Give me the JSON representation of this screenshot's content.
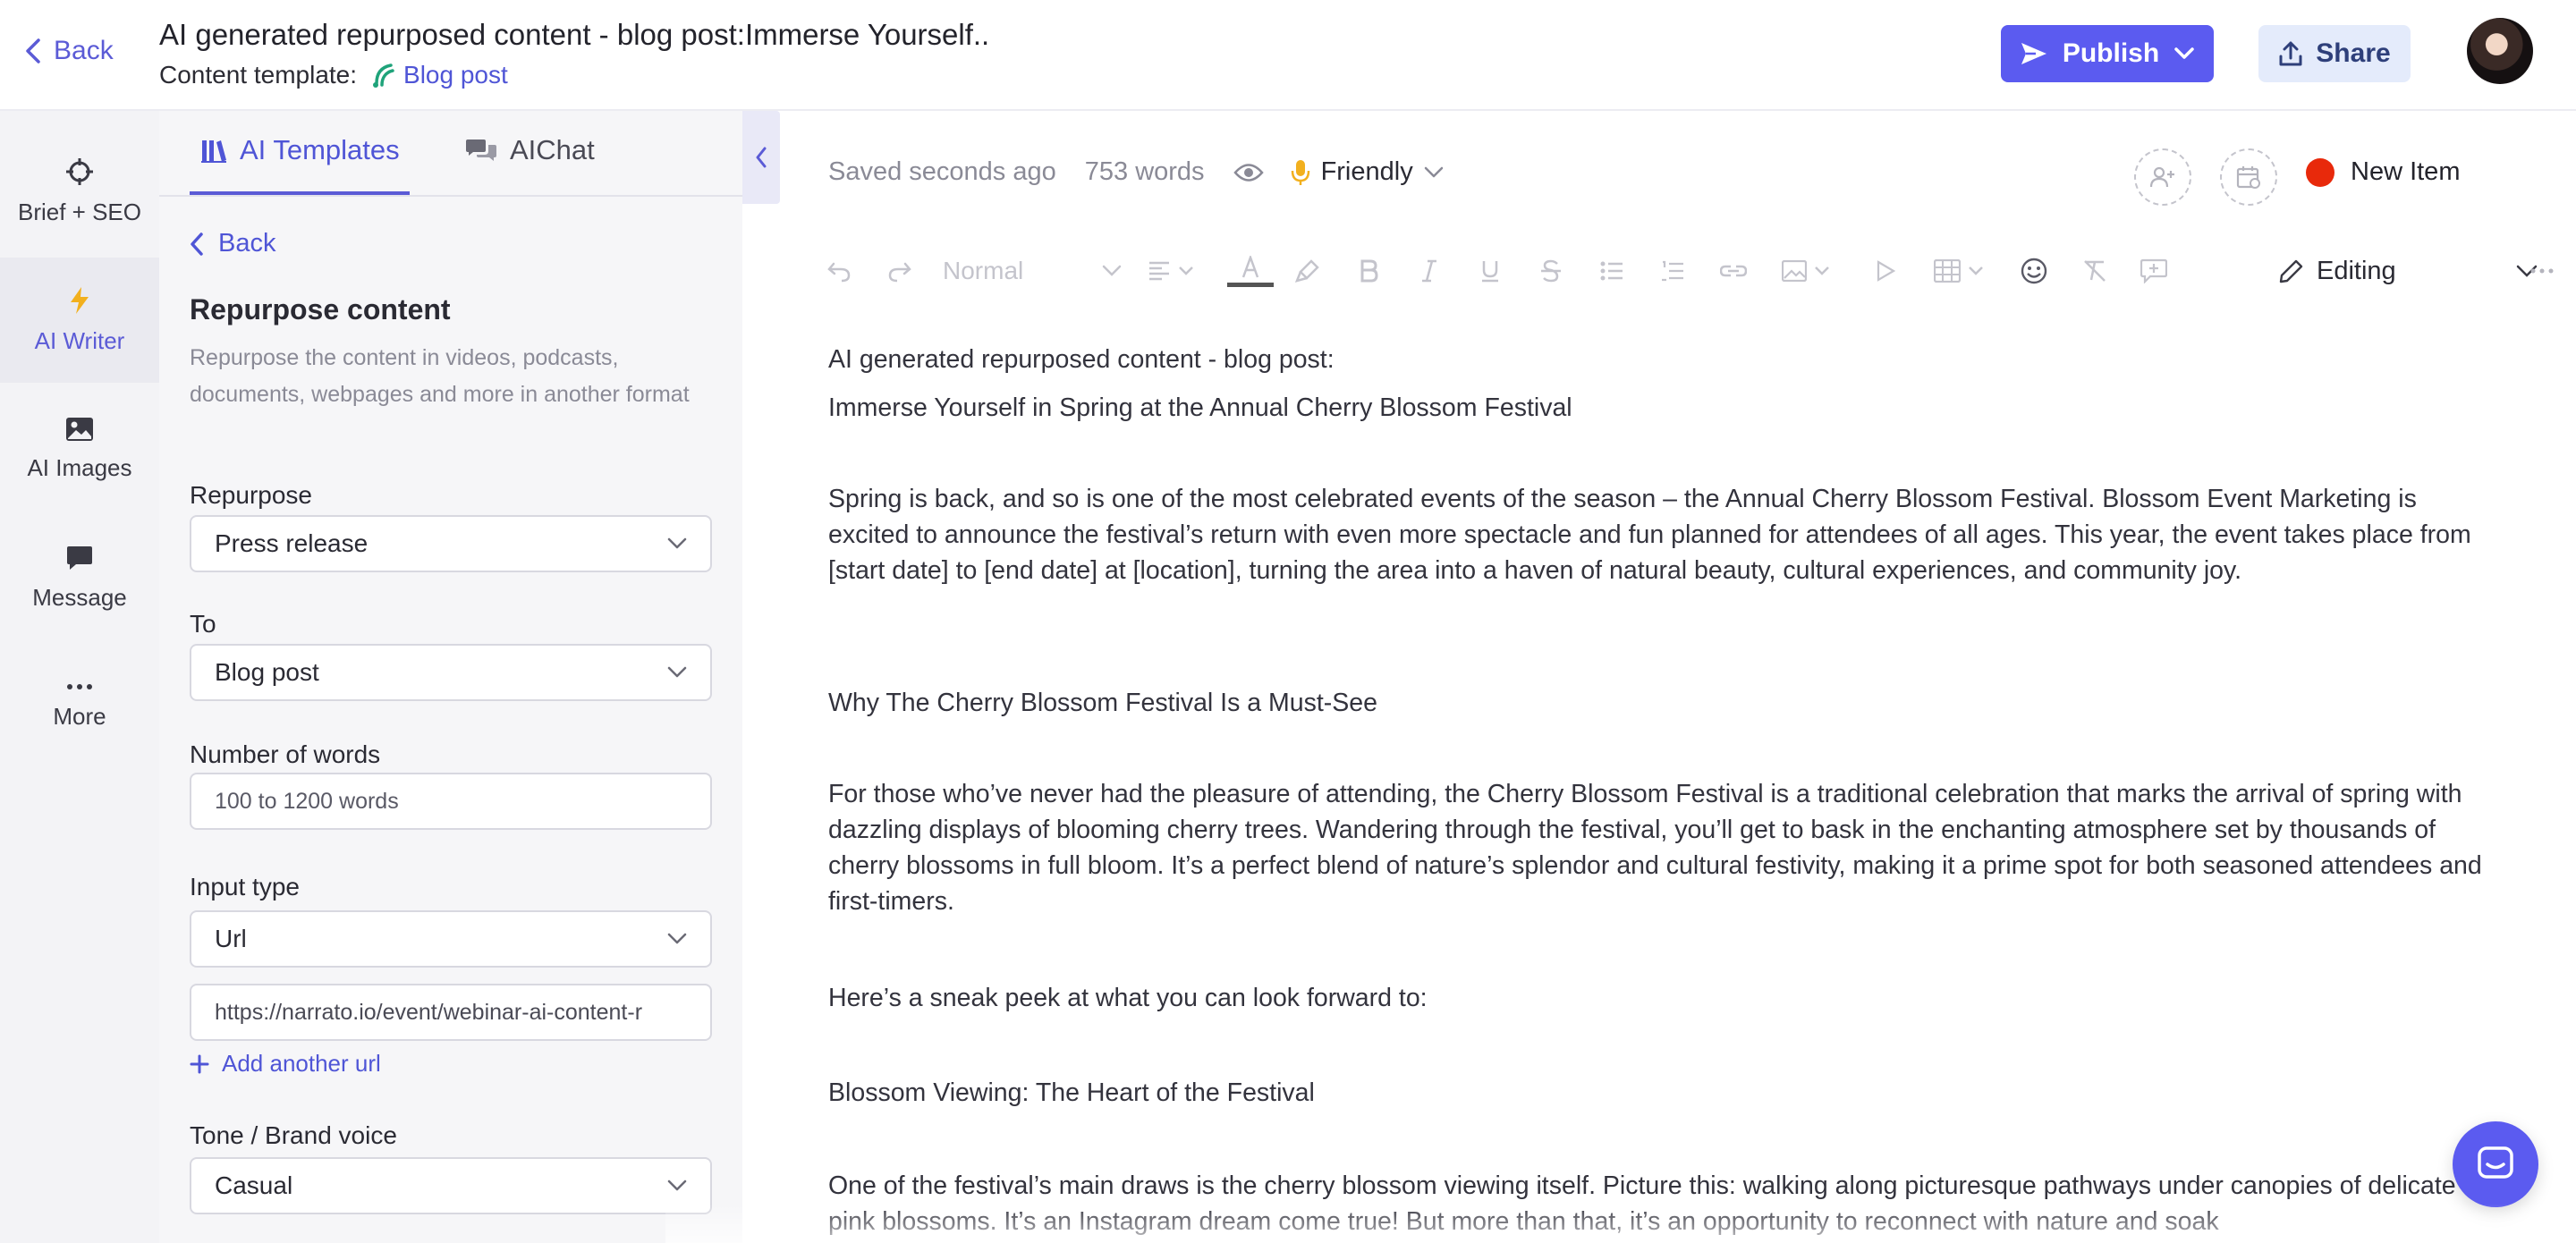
{
  "header": {
    "back_label": "Back",
    "title": "AI generated repurposed content - blog post:Immerse Yourself..",
    "content_template_label": "Content template:",
    "content_template_value": "Blog post",
    "publish_label": "Publish",
    "share_label": "Share"
  },
  "rail": {
    "items": [
      {
        "label": "Brief + SEO",
        "icon": "crosshair-icon"
      },
      {
        "label": "AI Writer",
        "icon": "lightning-icon",
        "active": true
      },
      {
        "label": "AI Images",
        "icon": "image-icon"
      },
      {
        "label": "Message",
        "icon": "message-icon"
      },
      {
        "label": "More",
        "icon": "more-dots-icon"
      }
    ]
  },
  "panel": {
    "tabs": [
      {
        "label": "AI Templates",
        "icon": "library-icon",
        "active": true
      },
      {
        "label": "AIChat",
        "icon": "chat-bubbles-icon",
        "active": false
      }
    ],
    "back_label": "Back",
    "title": "Repurpose content",
    "description": "Repurpose the content in videos, podcasts, documents, webpages and more in another format",
    "repurpose_label": "Repurpose",
    "repurpose_value": "Press release",
    "to_label": "To",
    "to_value": "Blog post",
    "words_label": "Number of words",
    "words_placeholder": "100 to 1200 words",
    "input_type_label": "Input type",
    "input_type_value": "Url",
    "url_value": "https://narrato.io/event/webinar-ai-content-r",
    "add_url_label": "Add another url",
    "tone_label": "Tone / Brand voice",
    "tone_value": "Casual"
  },
  "editor": {
    "saved_status": "Saved seconds ago",
    "word_count": "753 words",
    "tone": "Friendly",
    "stage": "New Item",
    "stage_color": "#e8290b",
    "toolbar_style": "Normal",
    "mode": "Editing",
    "paragraphs": [
      "AI generated repurposed content - blog post:",
      "Immerse Yourself in Spring at the Annual Cherry Blossom Festival",
      "Spring is back, and so is one of the most celebrated events of the season – the Annual Cherry Blossom Festival. Blossom Event Marketing is excited to announce the festival’s return with even more spectacle and fun planned for attendees of all ages. This year, the event takes place from [start date] to [end date] at [location], turning the area into a haven of natural beauty, cultural experiences, and community joy.",
      "Why The Cherry Blossom Festival Is a Must-See",
      "For those who’ve never had the pleasure of attending, the Cherry Blossom Festival is a traditional celebration that marks the arrival of spring with dazzling displays of blooming cherry trees. Wandering through the festival, you’ll get to bask in the enchanting atmosphere set by thousands of cherry blossoms in full bloom. It’s a perfect blend of nature’s splendor and cultural festivity, making it a prime spot for both seasoned attendees and first-timers.",
      "Here’s a sneak peek at what you can look forward to:",
      "Blossom Viewing: The Heart of the Festival",
      "One of the festival’s main draws is the cherry blossom viewing itself. Picture this: walking along picturesque pathways under canopies of delicate pink blossoms. It’s an Instagram dream come true! But more than that, it’s an opportunity to reconnect with nature and soak"
    ]
  },
  "colors": {
    "accent": "#5b5bf0",
    "link": "#4f55d6",
    "share_bg": "#e4ebfb"
  }
}
